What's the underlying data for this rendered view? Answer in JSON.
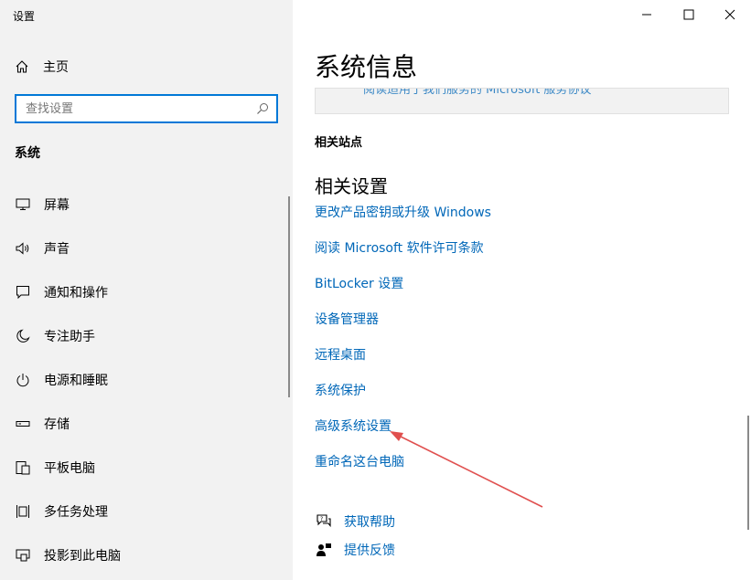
{
  "window": {
    "title": "设置"
  },
  "sidebar": {
    "home_label": "主页",
    "search_placeholder": "查找设置",
    "section_label": "系统",
    "items": [
      {
        "label": "屏幕",
        "icon": "monitor-icon"
      },
      {
        "label": "声音",
        "icon": "speaker-icon"
      },
      {
        "label": "通知和操作",
        "icon": "notification-icon"
      },
      {
        "label": "专注助手",
        "icon": "moon-icon"
      },
      {
        "label": "电源和睡眠",
        "icon": "power-icon"
      },
      {
        "label": "存储",
        "icon": "storage-icon"
      },
      {
        "label": "平板电脑",
        "icon": "tablet-icon"
      },
      {
        "label": "多任务处理",
        "icon": "multitask-icon"
      },
      {
        "label": "投影到此电脑",
        "icon": "project-icon"
      }
    ]
  },
  "main": {
    "title": "系统信息",
    "partial_link": "阅读适用于我们服务的 Microsoft 服务协议",
    "related_sites_label": "相关站点",
    "related_settings_title": "相关设置",
    "links": [
      "更改产品密钥或升级 Windows",
      "阅读 Microsoft 软件许可条款",
      "BitLocker 设置",
      "设备管理器",
      "远程桌面",
      "系统保护",
      "高级系统设置",
      "重命名这台电脑"
    ],
    "help": [
      {
        "label": "获取帮助",
        "icon": "help-chat-icon"
      },
      {
        "label": "提供反馈",
        "icon": "feedback-icon"
      }
    ]
  },
  "colors": {
    "accent": "#0067b8",
    "focus": "#0078d7",
    "sidebar_bg": "#f2f2f2",
    "annotation": "#e0504f"
  }
}
